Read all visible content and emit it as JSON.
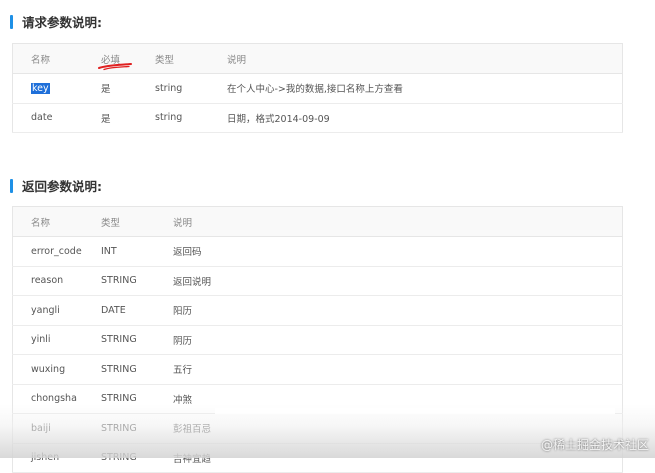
{
  "request_section": {
    "title": "请求参数说明:",
    "headers": [
      "名称",
      "必填",
      "类型",
      "说明"
    ],
    "rows": [
      {
        "name": "key",
        "required": "是",
        "type": "string",
        "desc": "在个人中心->我的数据,接口名称上方查看"
      },
      {
        "name": "date",
        "required": "是",
        "type": "string",
        "desc": "日期，格式2014-09-09"
      }
    ]
  },
  "return_section": {
    "title": "返回参数说明:",
    "headers": [
      "名称",
      "类型",
      "说明"
    ],
    "rows": [
      {
        "name": "error_code",
        "type": "INT",
        "desc": "返回码"
      },
      {
        "name": "reason",
        "type": "STRING",
        "desc": "返回说明"
      },
      {
        "name": "yangli",
        "type": "DATE",
        "desc": "阳历"
      },
      {
        "name": "yinli",
        "type": "STRING",
        "desc": "阴历"
      },
      {
        "name": "wuxing",
        "type": "STRING",
        "desc": "五行"
      },
      {
        "name": "chongsha",
        "type": "STRING",
        "desc": "冲煞"
      },
      {
        "name": "baiji",
        "type": "STRING",
        "desc": "彭祖百忌"
      },
      {
        "name": "jishen",
        "type": "STRING",
        "desc": "吉神宜趋"
      }
    ]
  },
  "watermark": "@稀土掘金技术社区",
  "colors": {
    "accent": "#1e90e6",
    "selection": "#1e6fd9",
    "annotation": "#e02020"
  }
}
